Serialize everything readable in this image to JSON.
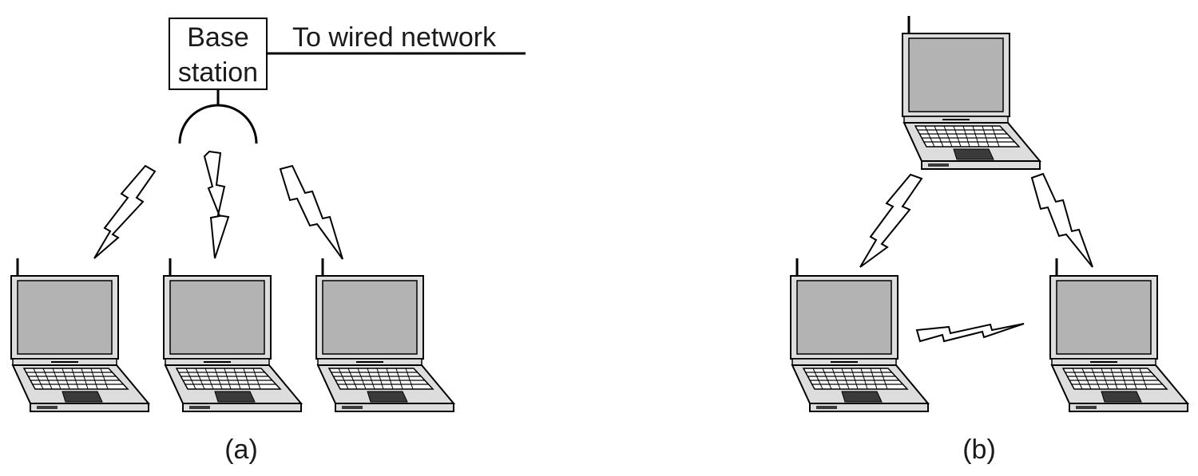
{
  "diagram_a": {
    "base_station_line1": "Base",
    "base_station_line2": "station",
    "wired_label": "To wired network",
    "caption": "(a)"
  },
  "diagram_b": {
    "caption": "(b)"
  },
  "colors": {
    "screen": "#b3b3b3",
    "body": "#dddddd",
    "keys": "#ffffff",
    "touchpad": "#3a3a3a",
    "outline": "#000000"
  },
  "icons": [
    "laptop-icon",
    "antenna-icon",
    "lightning-bolt-icon",
    "base-station-box"
  ]
}
